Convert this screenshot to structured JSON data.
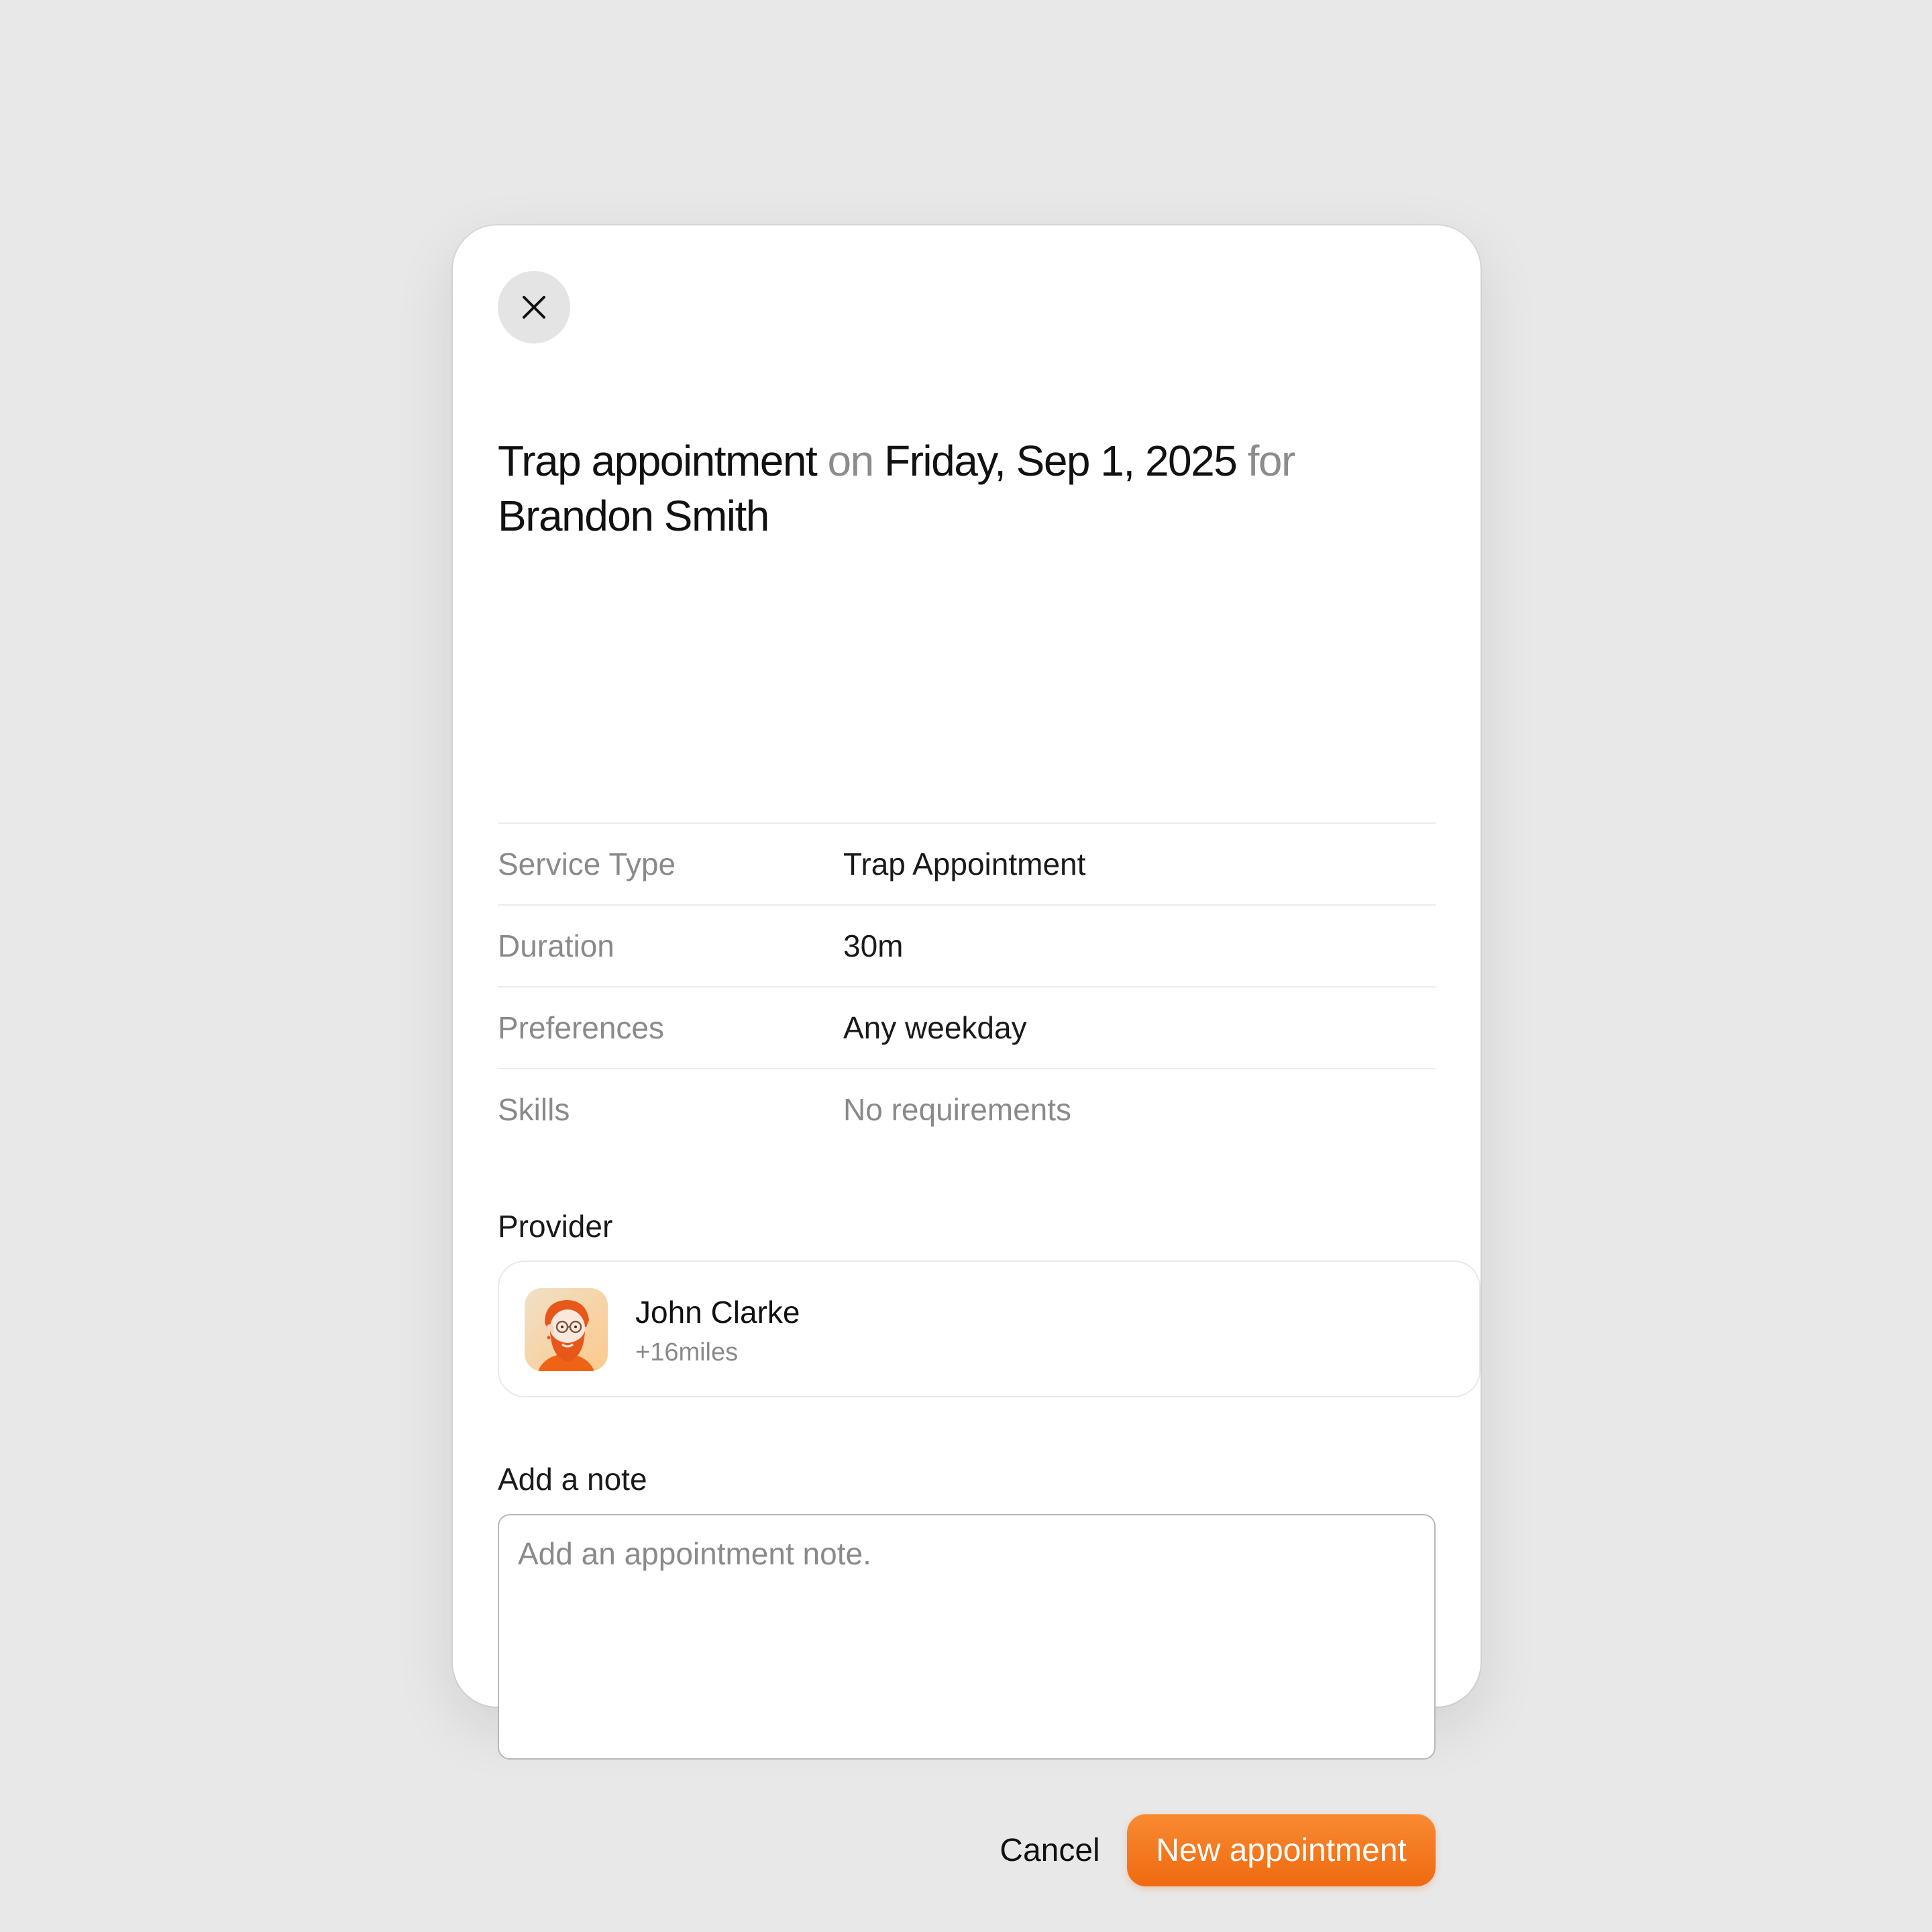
{
  "dialog": {
    "title": {
      "service": "Trap appointment",
      "on": " on ",
      "date": "Friday, Sep 1, 2025",
      "for": " for ",
      "client": "Brandon Smith"
    },
    "details": [
      {
        "label": "Service Type",
        "value": "Trap Appointment",
        "muted": false
      },
      {
        "label": "Duration",
        "value": "30m",
        "muted": false
      },
      {
        "label": "Preferences",
        "value": "Any weekday",
        "muted": false
      },
      {
        "label": "Skills",
        "value": "No requirements",
        "muted": true
      }
    ],
    "provider": {
      "section_label": "Provider",
      "name": "John Clarke",
      "distance": "+16miles",
      "avatar_icon": "bearded-man-avatar"
    },
    "note": {
      "section_label": "Add a note",
      "placeholder": "Add an appointment note.",
      "value": ""
    },
    "actions": {
      "cancel_label": "Cancel",
      "submit_label": "New appointment"
    },
    "icons": {
      "close": "close-icon"
    },
    "colors": {
      "accent": "#ef6a10",
      "accent_light": "#f98a32",
      "muted_text": "#8a8a8a",
      "background": "#e8e8e8"
    }
  }
}
